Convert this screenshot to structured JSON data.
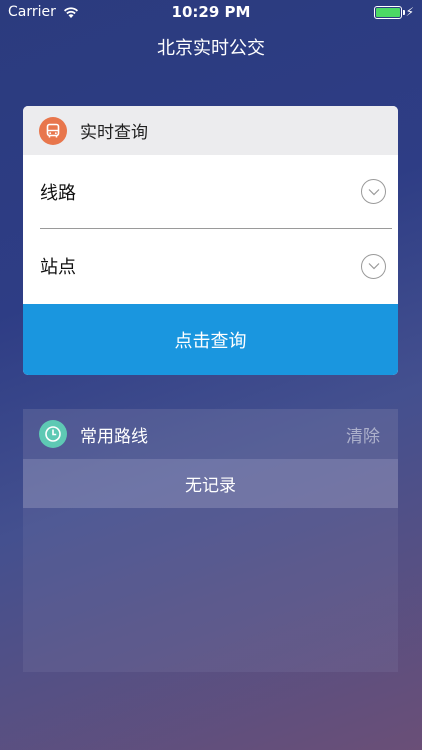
{
  "status_bar": {
    "carrier": "Carrier",
    "time": "10:29 PM",
    "battery_percent": 100,
    "battery_color": "#4cd964"
  },
  "nav": {
    "title": "北京实时公交"
  },
  "query_card": {
    "icon": "bus-icon",
    "icon_color": "#e8764c",
    "title": "实时查询",
    "route_label": "线路",
    "station_label": "站点",
    "button_label": "点击查询",
    "button_color": "#1a96df"
  },
  "favorites": {
    "icon": "clock-icon",
    "icon_color": "#5ec9b4",
    "title": "常用路线",
    "clear_label": "清除",
    "empty_text": "无记录"
  }
}
